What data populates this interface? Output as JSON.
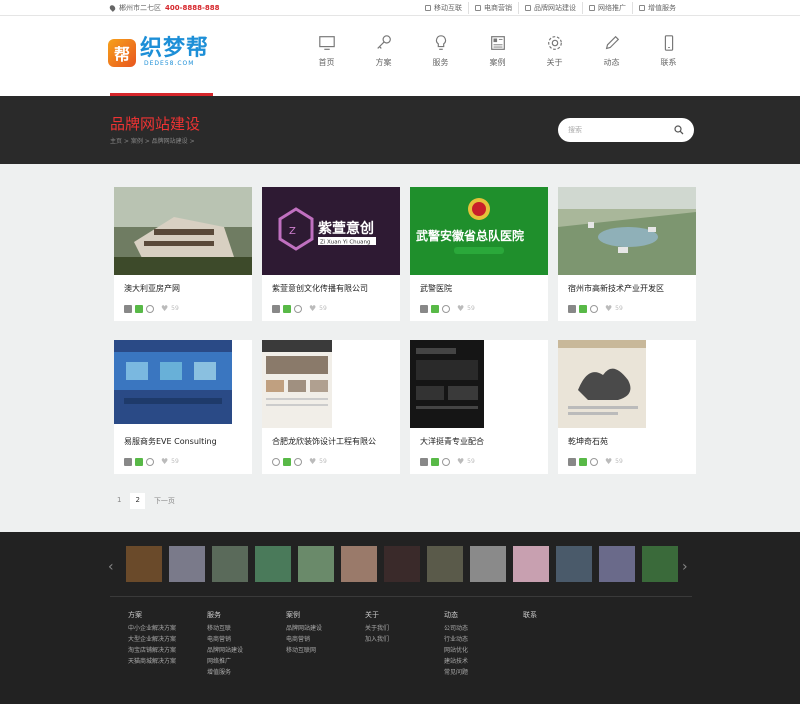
{
  "topbar": {
    "location": "郴州市二七区",
    "phone": "400-8888-888",
    "links": [
      "移动互联",
      "电商营销",
      "品牌网站建设",
      "网络推广",
      "增值服务"
    ]
  },
  "logo": {
    "mark": "帮",
    "name": "织梦帮",
    "sub": "DEDE58.COM"
  },
  "nav": [
    {
      "label": "首页",
      "icon": "monitor-icon"
    },
    {
      "label": "方案",
      "icon": "key-icon"
    },
    {
      "label": "服务",
      "icon": "lightbulb-icon"
    },
    {
      "label": "案例",
      "icon": "newspaper-icon"
    },
    {
      "label": "关于",
      "icon": "gear-icon"
    },
    {
      "label": "动态",
      "icon": "pencil-icon"
    },
    {
      "label": "联系",
      "icon": "phone-icon"
    }
  ],
  "banner": {
    "title": "品牌网站建设",
    "breadcrumb": "主页 > 案例 > 品牌网站建设 >",
    "search_placeholder": "搜索"
  },
  "cases": [
    {
      "title": "澳大利亚房产网",
      "likes": "59",
      "color": "#5a6a4a"
    },
    {
      "title": "紫萱意创文化传播有限公司",
      "likes": "59",
      "color": "#3a1e3e"
    },
    {
      "title": "武警医院",
      "likes": "59",
      "color": "#1d8f2a"
    },
    {
      "title": "宿州市高新技术产业开发区",
      "likes": "59",
      "color": "#8aa07a"
    },
    {
      "title": "易服商务EVE Consulting",
      "likes": "59",
      "color": "#2b4a8a"
    },
    {
      "title": "合肥龙欣装饰设计工程有限公",
      "likes": "59",
      "color": "#e8e4dc"
    },
    {
      "title": "大洋挺青专业配合",
      "likes": "59",
      "color": "#1a1a1a"
    },
    {
      "title": "乾坤奇石苑",
      "likes": "59",
      "color": "#d8d2c6"
    }
  ],
  "thumb_texts": {
    "ziy": "紫萱意创",
    "ziy_sub": "Zi Xuan Yi Chuang",
    "hospital": "武警安徽省总队医院"
  },
  "pager": {
    "p1": "1",
    "p2": "2",
    "next": "下一页"
  },
  "footer": {
    "photos": [
      "#6a4a2a",
      "#7a7a8a",
      "#5a6a5a",
      "#4a7a5a",
      "#6a8a6a",
      "#9a7a6a",
      "#3a2a2a",
      "#5a5a4a",
      "#8a8a8a",
      "#c8a0b0",
      "#4a5a6a",
      "#6a6a8a",
      "#3a6a3a"
    ],
    "cols": [
      {
        "h": "方案",
        "items": [
          "中小企业解决方案",
          "大型企业解决方案",
          "淘宝店铺解决方案",
          "天猫商城解决方案"
        ]
      },
      {
        "h": "服务",
        "items": [
          "移动互联",
          "电商营销",
          "品牌网站建设",
          "网络推广",
          "增值服务"
        ]
      },
      {
        "h": "案例",
        "items": [
          "品牌网站建设",
          "电商营销",
          "移动互联网"
        ]
      },
      {
        "h": "关于",
        "items": [
          "关于我们",
          "加入我们"
        ]
      },
      {
        "h": "动态",
        "items": [
          "公司动态",
          "行业动态",
          "网站优化",
          "建站技术",
          "常见问题"
        ]
      },
      {
        "h": "联系",
        "items": []
      }
    ]
  }
}
